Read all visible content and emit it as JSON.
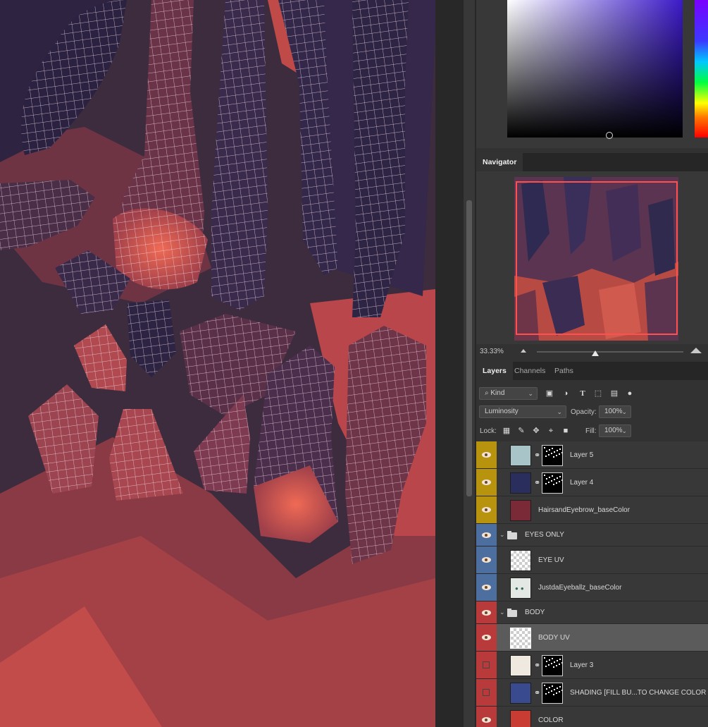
{
  "document": {
    "canvas_description_colors": {
      "base": "#3e2e40",
      "red": "#b54545",
      "wire": "#ffffff"
    }
  },
  "navigator": {
    "tab_label": "Navigator",
    "zoom": "33.33%",
    "zoom_fraction": 0.4
  },
  "layers_panel": {
    "tabs": [
      "Layers",
      "Channels",
      "Paths"
    ],
    "filter_kind": "Kind",
    "blend_mode": "Luminosity",
    "opacity_label": "Opacity:",
    "opacity_value": "100%",
    "lock_label": "Lock:",
    "fill_label": "Fill:",
    "fill_value": "100%",
    "layers": [
      {
        "name": "Layer 5",
        "visible": true,
        "tag_color": "#b8930e",
        "type": "layer",
        "thumb": "#a8c4c8",
        "mask": true
      },
      {
        "name": "Layer 4",
        "visible": true,
        "tag_color": "#b8930e",
        "type": "layer",
        "thumb": "#2a2e5c",
        "mask": true
      },
      {
        "name": "HairsandEyebrow_baseColor",
        "visible": true,
        "tag_color": "#b8930e",
        "type": "layer",
        "thumb": "#7a2a36",
        "mask": false
      },
      {
        "name": "EYES ONLY",
        "visible": true,
        "tag_color": "#4d6fa0",
        "type": "group"
      },
      {
        "name": "EYE UV",
        "visible": true,
        "tag_color": "#4d6fa0",
        "type": "layer",
        "thumb": "checker",
        "mask": false
      },
      {
        "name": "JustdaEyeballz_baseColor",
        "visible": true,
        "tag_color": "#4d6fa0",
        "type": "layer",
        "thumb": "#e4e8e4",
        "mask": false
      },
      {
        "name": "BODY",
        "visible": true,
        "tag_color": "#b83a3a",
        "type": "group"
      },
      {
        "name": "BODY UV",
        "visible": true,
        "tag_color": "#b83a3a",
        "type": "layer",
        "thumb": "checker",
        "mask": false,
        "selected": true
      },
      {
        "name": "Layer 3",
        "visible": false,
        "tag_color": "#b83a3a",
        "type": "layer",
        "thumb": "#efe9df",
        "mask": true
      },
      {
        "name": "SHADING [FILL BU...TO CHANGE COLOR",
        "visible": false,
        "tag_color": "#b83a3a",
        "type": "layer",
        "thumb": "#3a4a8e",
        "mask": true
      },
      {
        "name": "COLOR",
        "visible": true,
        "tag_color": "#b83a3a",
        "type": "layer",
        "thumb": "#c83c34",
        "mask": false
      }
    ]
  }
}
